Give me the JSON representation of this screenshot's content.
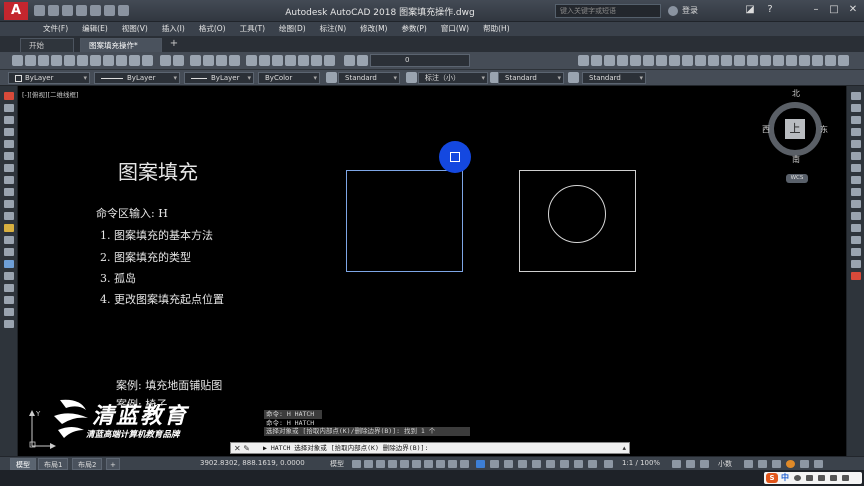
{
  "window": {
    "title": "Autodesk AutoCAD 2018    图案填充操作.dwg",
    "search_placeholder": "键入关键字或短语",
    "login": "登录"
  },
  "menu": [
    "文件(F)",
    "编辑(E)",
    "视图(V)",
    "插入(I)",
    "格式(O)",
    "工具(T)",
    "绘图(D)",
    "标注(N)",
    "修改(M)",
    "参数(P)",
    "窗口(W)",
    "帮助(H)"
  ],
  "tabs": [
    {
      "label": "开始"
    },
    {
      "label": "图案填充操作*"
    }
  ],
  "toolbar1": {
    "layer_value": "0"
  },
  "properties": {
    "color": "ByLayer",
    "linetype": "ByLayer",
    "lineweight": "ByLayer",
    "plotstyle": "ByColor",
    "text_style": "Standard",
    "dim_style": "标注（小）",
    "table_style": "Standard",
    "mleader_style": "Standard"
  },
  "viewport_label": "[-][俯视][二维线框]",
  "drawing_text": {
    "heading": "图案填充",
    "command_hint": "命令区输入: H",
    "items": [
      "1. 图案填充的基本方法",
      "2. 图案填充的类型",
      "3. 孤岛",
      "4. 更改图案填充起点位置"
    ],
    "example1": "案例: 填充地面铺贴图",
    "example2": "案例: 椅子"
  },
  "viewcube": {
    "north": "北",
    "south": "南",
    "east": "东",
    "west": "西",
    "face": "上",
    "wcs": "WCS"
  },
  "watermark": {
    "title": "清蓝教育",
    "subtitle": "清蓝高端计算机教育品牌"
  },
  "command_history": [
    "命令: H HATCH",
    "命令: H HATCH",
    "选择对象或 [拾取内部点(K)/删除边界(B)]: 找到 1 个"
  ],
  "command_line": "▶ HATCH 选择对象或 [拾取内部点(K) 删除边界(B)]:",
  "layout_tabs": [
    "模型",
    "布局1",
    "布局2"
  ],
  "status": {
    "coords": "3902.8302, 888.1619, 0.0000",
    "model": "模型",
    "scale": "1:1 / 100%",
    "units": "小数"
  },
  "tray": {
    "s_badge": "S",
    "lang": "中"
  },
  "colors": {
    "accent_blue": "#1448e0",
    "selected_rect": "#7ea6e6",
    "logo_red": "#c4262e"
  }
}
